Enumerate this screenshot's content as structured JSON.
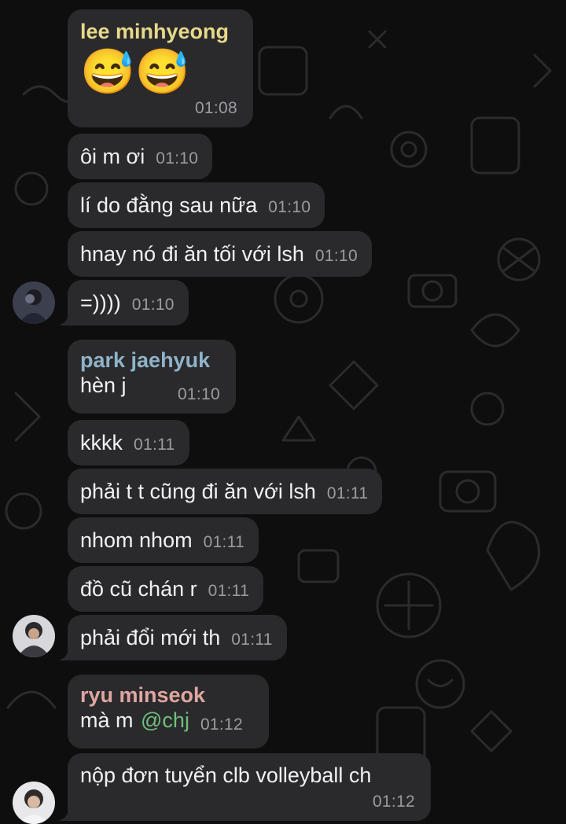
{
  "colors": {
    "bubble": "#2a2a2c",
    "background": "#0e0e0f",
    "sender_lee": "#e7d98a",
    "sender_park": "#8fb3c9",
    "sender_ryu": "#e0a6a0",
    "mention": "#6fbf7d",
    "time": "#9b9ba2"
  },
  "messages": [
    {
      "sender": "lee minhyeong",
      "emoji": "😅😅",
      "time": "01:08"
    },
    {
      "text": "ôi m ơi",
      "time": "01:10"
    },
    {
      "text": "lí do đằng sau nữa",
      "time": "01:10"
    },
    {
      "text": "hnay nó đi ăn tối với lsh",
      "time": "01:10"
    },
    {
      "text": "=))))",
      "time": "01:10"
    },
    {
      "sender": "park jaehyuk",
      "text": "hèn j",
      "time": "01:10"
    },
    {
      "text": "kkkk",
      "time": "01:11"
    },
    {
      "text": "phải t t cũng đi ăn với lsh",
      "time": "01:11"
    },
    {
      "text": "nhom nhom",
      "time": "01:11"
    },
    {
      "text": "đồ cũ chán r",
      "time": "01:11"
    },
    {
      "text": "phải đổi mới th",
      "time": "01:11"
    },
    {
      "sender": "ryu minseok",
      "text": "mà m",
      "mention": "@chj",
      "time": "01:12"
    },
    {
      "text": "nộp đơn tuyển clb volleyball ch",
      "time": "01:12"
    }
  ]
}
